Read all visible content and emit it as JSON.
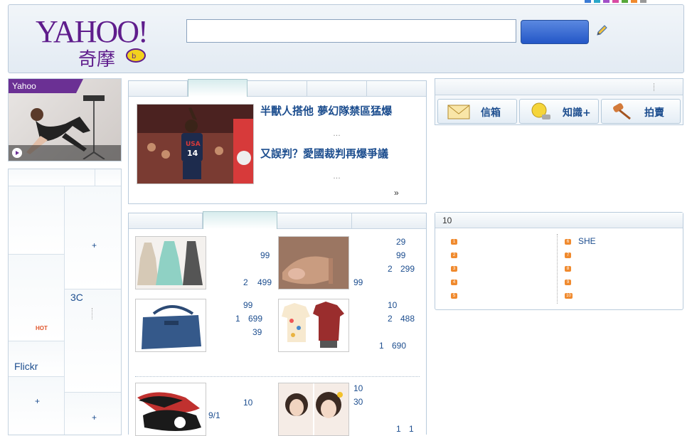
{
  "header": {
    "logo_text": "YAHOO!",
    "logo_sub": "奇摩",
    "search_placeholder": "",
    "search_button_label": ""
  },
  "video": {
    "tag": "Yahoo"
  },
  "left_menu": {
    "plus_1": "+",
    "cat_3c": "3C",
    "hot_badge": "HOT",
    "flickr": "Flickr",
    "plus_2": "+",
    "plus_3": "+"
  },
  "news": {
    "headline_1": "半獸人搭他 夢幻隊禁區猛爆",
    "ellipsis_1": "…",
    "headline_2": "又誤判？愛國裁判再爆爭議",
    "ellipsis_2": "…",
    "more": "»",
    "photo_caption": "14"
  },
  "services": {
    "mail": "信箱",
    "knowledge": "知識+",
    "auction": "拍賣"
  },
  "ranking": {
    "title": "10",
    "left_badges": [
      "1",
      "2",
      "3",
      "4",
      "5"
    ],
    "right_badges": [
      "6",
      "7",
      "8",
      "9",
      "10"
    ],
    "right_first_item": "SHE"
  },
  "shopping": {
    "p1": [
      "99",
      "2",
      "499"
    ],
    "p2": [
      "29",
      "99",
      "2",
      "299",
      "99"
    ],
    "p3": [
      "99",
      "1",
      "699",
      "39"
    ],
    "p4": [
      "10",
      "2",
      "488",
      "1",
      "690"
    ],
    "p5": [
      "10",
      "9/1"
    ],
    "p6": [
      "10",
      "30",
      "1",
      "1"
    ]
  },
  "colors": {
    "brand_purple": "#5f1d8c",
    "link_blue": "#1d4e8f",
    "search_blue": "#2457c7",
    "accent_orange": "#f08a2e"
  }
}
